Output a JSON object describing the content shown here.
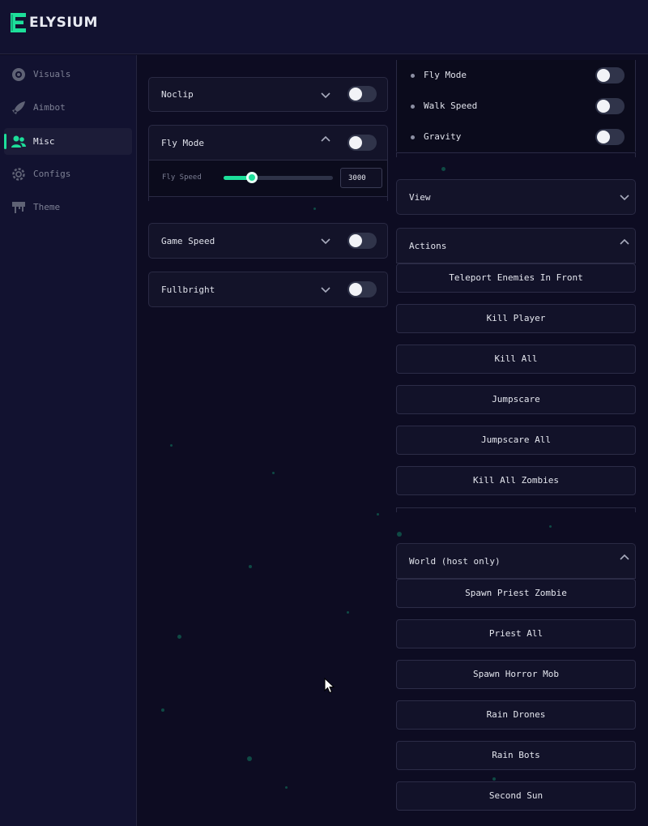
{
  "brand": {
    "name": "ELYSIUM",
    "accent": "#1ddf9a"
  },
  "sidebar": {
    "items": [
      {
        "label": "Visuals",
        "icon": "eye-icon",
        "active": false
      },
      {
        "label": "Aimbot",
        "icon": "rocket-icon",
        "active": false
      },
      {
        "label": "Misc",
        "icon": "users-icon",
        "active": true
      },
      {
        "label": "Configs",
        "icon": "gear-icon",
        "active": false
      },
      {
        "label": "Theme",
        "icon": "paint-drip-icon",
        "active": false
      }
    ]
  },
  "left_column": {
    "noclip": {
      "label": "Noclip",
      "enabled": false
    },
    "fly_mode": {
      "label": "Fly Mode",
      "enabled": false,
      "expanded": true,
      "fly_speed": {
        "label": "Fly Speed",
        "value": "3000",
        "fraction": 0.26
      }
    },
    "game_speed": {
      "label": "Game Speed",
      "enabled": false
    },
    "fullbright": {
      "label": "Fullbright",
      "enabled": false
    }
  },
  "right_column": {
    "movement_rows": [
      {
        "label": "Fly Mode",
        "enabled": false
      },
      {
        "label": "Walk Speed",
        "enabled": false
      },
      {
        "label": "Gravity",
        "enabled": false
      }
    ],
    "view": {
      "label": "View",
      "expanded": false
    },
    "actions": {
      "label": "Actions",
      "expanded": true,
      "buttons": [
        "Teleport Enemies In Front",
        "Kill Player",
        "Kill All",
        "Jumpscare",
        "Jumpscare All",
        "Kill All Zombies"
      ]
    },
    "world": {
      "label": "World (host only)",
      "expanded": true,
      "buttons": [
        "Spawn Priest Zombie",
        "Priest All",
        "Spawn Horror Mob",
        "Rain Drones",
        "Rain Bots",
        "Second Sun"
      ]
    }
  }
}
